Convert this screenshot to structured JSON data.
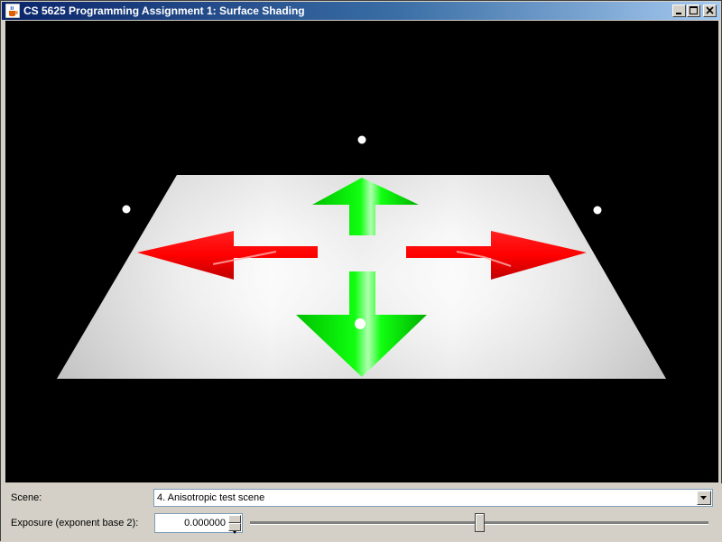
{
  "window": {
    "title": "CS 5625 Programming Assignment 1: Surface Shading",
    "icon": "java-coffee-icon"
  },
  "controls": {
    "scene_label": "Scene:",
    "scene_selected": "4. Anisotropic test scene",
    "exposure_label": "Exposure (exponent base 2):",
    "exposure_value": "0.000000",
    "exposure_slider_fraction": 0.5
  },
  "viewport": {
    "scene": "checkered-plane-with-arrows",
    "colors": {
      "background": "#000000",
      "plane": "#e0e0e0",
      "red_arrow": "#ff0000",
      "green_arrow": "#00ff00",
      "light": "#ffffff"
    }
  }
}
